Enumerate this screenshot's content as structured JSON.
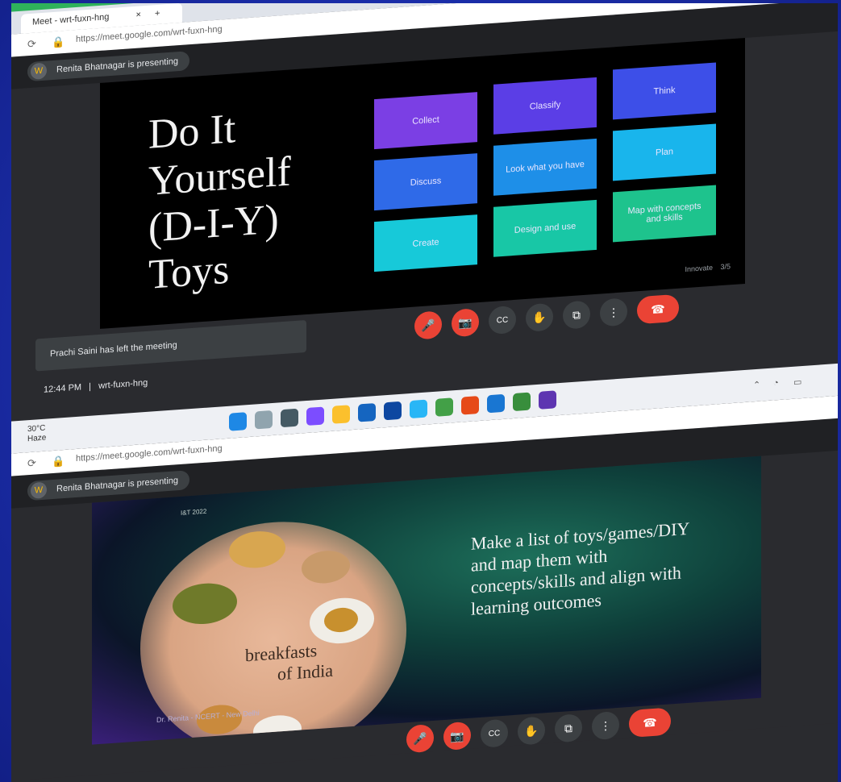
{
  "browser_top": {
    "tab_title": "Meet - wrt-fuxn-hng",
    "url": "https://meet.google.com/wrt-fuxn-hng"
  },
  "meet_top": {
    "presenter_text": "Renita Bhatnagar is presenting"
  },
  "slide_top": {
    "title_lines": [
      "Do It",
      "Yourself",
      "(D-I-Y)",
      "Toys"
    ],
    "tiles": [
      {
        "label": "Collect",
        "color": "#7b3fe4"
      },
      {
        "label": "Classify",
        "color": "#5b3ee6"
      },
      {
        "label": "Think",
        "color": "#3d4fe8"
      },
      {
        "label": "Discuss",
        "color": "#2f6ae8"
      },
      {
        "label": "Look what you have",
        "color": "#1e8fe8"
      },
      {
        "label": "Plan",
        "color": "#19b5ec"
      },
      {
        "label": "Create",
        "color": "#17c9d9"
      },
      {
        "label": "Design and use",
        "color": "#18c7a6"
      },
      {
        "label": "Map with concepts and skills",
        "color": "#1ec38d"
      }
    ],
    "footer_left": "Innovate",
    "footer_right": "3/5"
  },
  "notification": "Prachi Saini has left the meeting",
  "meeting_status": {
    "time": "12:44 PM",
    "separator": "|",
    "code": "wrt-fuxn-hng"
  },
  "taskbar_top": {
    "weather_temp": "30°C",
    "weather_desc": "Haze"
  },
  "browser_bottom": {
    "url": "https://meet.google.com/wrt-fuxn-hng"
  },
  "meet_bottom": {
    "presenter_text": "Renita Bhatnagar is presenting"
  },
  "slide_bottom": {
    "small_label": "I&T 2022",
    "food_text_line1": "breakfasts",
    "food_text_line2": "of India",
    "body_text": "Make a list of toys/games/DIY and map them with concepts/skills and align with learning outcomes",
    "footer": "Dr. Renita - NCERT - New Delhi"
  },
  "controls": {
    "mic": "🎤",
    "cam": "📷",
    "captions": "CC",
    "hand": "✋",
    "present": "⧉",
    "more": "⋮",
    "hangup": "☎"
  },
  "colors": {
    "background": "#1b2fb5",
    "meet_dark": "#202124",
    "red_control": "#ea4335",
    "chrome_green": "#2fb25b"
  }
}
